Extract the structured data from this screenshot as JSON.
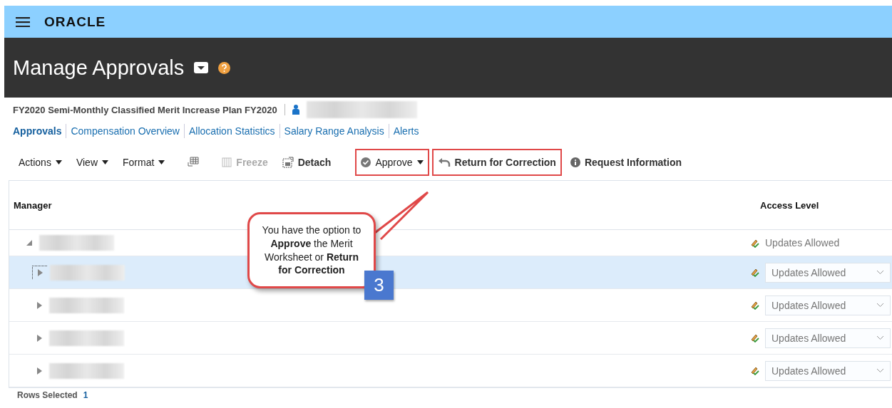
{
  "brand": {
    "logo": "ORACLE"
  },
  "page": {
    "title": "Manage Approvals"
  },
  "plan": {
    "name": "FY2020 Semi-Monthly Classified Merit Increase Plan FY2020"
  },
  "tabs": [
    {
      "label": "Approvals",
      "selected": true
    },
    {
      "label": "Compensation Overview",
      "selected": false
    },
    {
      "label": "Allocation Statistics",
      "selected": false
    },
    {
      "label": "Salary Range Analysis",
      "selected": false
    },
    {
      "label": "Alerts",
      "selected": false
    }
  ],
  "toolbar": [
    {
      "label": "Actions",
      "kind": "menu",
      "disabled": false,
      "highlighted": false
    },
    {
      "label": "View",
      "kind": "menu",
      "disabled": false,
      "highlighted": false
    },
    {
      "label": "Format",
      "kind": "menu",
      "disabled": false,
      "highlighted": false
    },
    {
      "kind": "grid-icon",
      "disabled": false,
      "highlighted": false
    },
    {
      "label": "Freeze",
      "kind": "freeze",
      "disabled": true,
      "highlighted": false
    },
    {
      "label": "Detach",
      "kind": "detach",
      "disabled": false,
      "highlighted": false
    },
    {
      "label": "Approve",
      "kind": "approve",
      "disabled": false,
      "highlighted": true
    },
    {
      "label": "Return for Correction",
      "kind": "return",
      "disabled": false,
      "highlighted": true
    },
    {
      "label": "Request Information",
      "kind": "info",
      "disabled": false,
      "highlighted": false
    }
  ],
  "table": {
    "columns": [
      "Manager",
      "Access Level"
    ],
    "rows": [
      {
        "expanded": true,
        "selected": false,
        "kind": "text",
        "access": "Updates Allowed",
        "children": [
          {
            "expanded": false,
            "selected": true,
            "kind": "select",
            "access": "Updates Allowed"
          },
          {
            "expanded": false,
            "selected": false,
            "kind": "select",
            "access": "Updates Allowed"
          },
          {
            "expanded": false,
            "selected": false,
            "kind": "select",
            "access": "Updates Allowed"
          },
          {
            "expanded": false,
            "selected": false,
            "kind": "select",
            "access": "Updates Allowed"
          }
        ]
      }
    ]
  },
  "footer": {
    "label": "Rows Selected",
    "count": "1"
  },
  "callout": {
    "text": "You have the option to **Approve** the Merit Worksheet or **Return for Correction**",
    "step": "3"
  }
}
